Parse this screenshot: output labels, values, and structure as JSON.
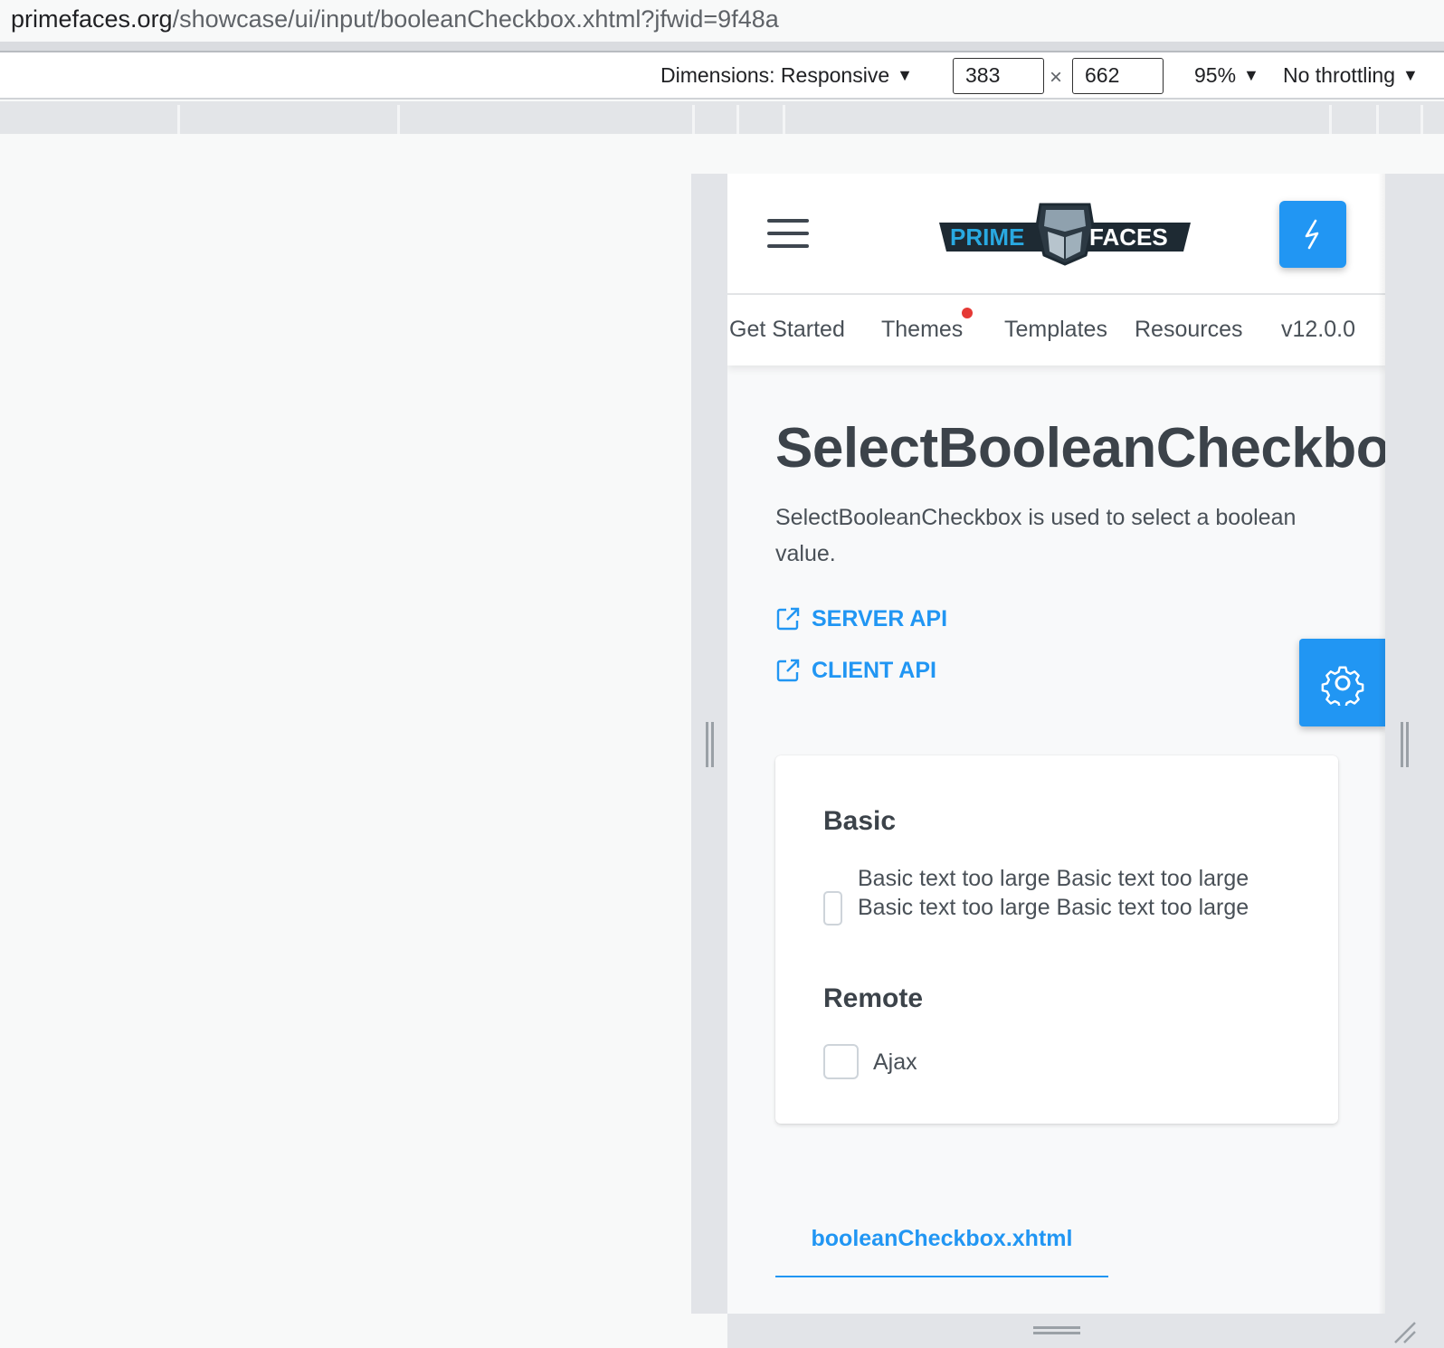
{
  "browser": {
    "url_host": "primefaces.org",
    "url_path": "/showcase/ui/input/booleanCheckbox.xhtml?jfwid=9f48a"
  },
  "devtools": {
    "dimensions_label": "Dimensions: Responsive",
    "width_value": "383",
    "height_value": "662",
    "times_symbol": "×",
    "zoom": "95%",
    "throttling": "No throttling",
    "dropdown_glyph": "▼"
  },
  "site": {
    "logo_left": "PRIME",
    "logo_right": "FACES",
    "nav": [
      "Get Started",
      "Themes",
      "Templates",
      "Resources",
      "v12.0.0"
    ],
    "theme_dot_color": "#e53935",
    "accent": "#2196f3"
  },
  "page": {
    "title": "SelectBooleanCheckbox",
    "description": "SelectBooleanCheckbox is used to select a boolean value.",
    "server_api": "SERVER API",
    "client_api": "CLIENT API"
  },
  "card": {
    "basic_title": "Basic",
    "basic_label": "Basic text too large Basic text too large Basic text too large Basic text too large",
    "basic_checked": false,
    "remote_title": "Remote",
    "remote_label": "Ajax",
    "remote_checked": false
  },
  "code_tab": {
    "label": "booleanCheckbox.xhtml"
  },
  "icons": [
    "hamburger-icon",
    "bolt-icon",
    "external-link-icon",
    "gear-icon",
    "resize-corner-icon"
  ]
}
